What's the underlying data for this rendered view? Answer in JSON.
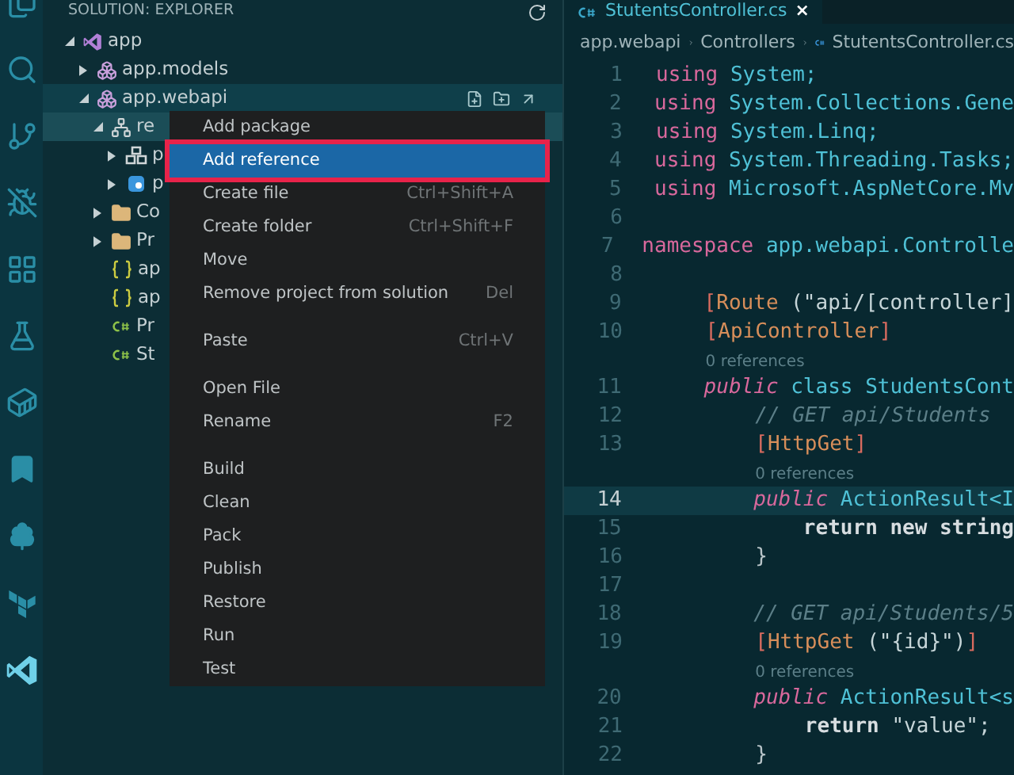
{
  "activity_bar": [
    {
      "kind": "files",
      "selected": false
    },
    {
      "kind": "search",
      "selected": false
    },
    {
      "kind": "source-control",
      "selected": false
    },
    {
      "kind": "debug",
      "selected": false
    },
    {
      "kind": "extensions",
      "selected": false
    },
    {
      "kind": "test",
      "selected": false
    },
    {
      "kind": "docker",
      "selected": false
    },
    {
      "kind": "bookmarks",
      "selected": false
    },
    {
      "kind": "tree",
      "selected": false
    },
    {
      "kind": "terraform",
      "selected": false
    },
    {
      "kind": "solution",
      "selected": true
    }
  ],
  "explorer": {
    "title": "SOLUTION: EXPLORER",
    "tree": [
      {
        "label": "app",
        "kind": "solution",
        "expanded": true,
        "selected": false,
        "hovered": false,
        "children": [
          {
            "label": "app.models",
            "kind": "project",
            "expanded": false,
            "selected": false,
            "hovered": false
          },
          {
            "label": "app.webapi",
            "kind": "project",
            "expanded": true,
            "selected": false,
            "hovered": true,
            "children": [
              {
                "label": "re",
                "kind": "references",
                "expanded": true,
                "selected": true,
                "hovered": false,
                "children": [
                  {
                    "label": "p",
                    "kind": "package",
                    "expanded": false,
                    "selected": false,
                    "hovered": false
                  },
                  {
                    "label": "p",
                    "kind": "nuget",
                    "expanded": false,
                    "selected": false,
                    "hovered": false
                  }
                ]
              },
              {
                "label": "Co",
                "kind": "folder",
                "expanded": false,
                "selected": false,
                "hovered": false
              },
              {
                "label": "Pr",
                "kind": "folder",
                "expanded": false,
                "selected": false,
                "hovered": false
              },
              {
                "label": "ap",
                "kind": "json",
                "selected": false,
                "hovered": false
              },
              {
                "label": "ap",
                "kind": "json",
                "selected": false,
                "hovered": false
              },
              {
                "label": "Pr",
                "kind": "csharp",
                "selected": false,
                "hovered": false
              },
              {
                "label": "St",
                "kind": "csharp",
                "selected": false,
                "hovered": false
              }
            ]
          }
        ]
      }
    ]
  },
  "context_menu": {
    "items": [
      {
        "label": "Add package",
        "selected": false
      },
      {
        "label": "Add reference",
        "selected": true
      },
      {
        "label": "Create file",
        "shortcut": "Ctrl+Shift+A",
        "selected": false
      },
      {
        "label": "Create folder",
        "shortcut": "Ctrl+Shift+F",
        "selected": false
      },
      {
        "label": "Move",
        "selected": false
      },
      {
        "label": "Remove project from solution",
        "shortcut": "Del",
        "selected": false,
        "separator_after": true
      },
      {
        "label": "Paste",
        "shortcut": "Ctrl+V",
        "selected": false,
        "separator_after": true
      },
      {
        "label": "Open File",
        "selected": false
      },
      {
        "label": "Rename",
        "shortcut": "F2",
        "selected": false,
        "separator_after": true
      },
      {
        "label": "Build",
        "selected": false
      },
      {
        "label": "Clean",
        "selected": false
      },
      {
        "label": "Pack",
        "selected": false
      },
      {
        "label": "Publish",
        "selected": false
      },
      {
        "label": "Restore",
        "selected": false
      },
      {
        "label": "Run",
        "selected": false
      },
      {
        "label": "Test",
        "selected": false
      }
    ]
  },
  "editor": {
    "tab": {
      "label": "StutentsController.cs",
      "close": "×"
    },
    "breadcrumb": [
      {
        "label": "app.webapi",
        "kind": "folder"
      },
      {
        "label": "Controllers",
        "kind": "folder"
      },
      {
        "label": "StutentsController.cs",
        "kind": "csharp"
      }
    ],
    "lines": [
      {
        "kind": "code",
        "number": "1",
        "current": false,
        "tokens": [
          {
            "kind": "kw",
            "text": "using"
          },
          {
            "kind": "type",
            "text": " System;"
          }
        ]
      },
      {
        "kind": "code",
        "number": "2",
        "current": false,
        "tokens": [
          {
            "kind": "kw",
            "text": "using"
          },
          {
            "kind": "type",
            "text": " System.Collections.Gene"
          }
        ]
      },
      {
        "kind": "code",
        "number": "3",
        "current": false,
        "tokens": [
          {
            "kind": "kw",
            "text": "using"
          },
          {
            "kind": "type",
            "text": " System.Linq;"
          }
        ]
      },
      {
        "kind": "code",
        "number": "4",
        "current": false,
        "tokens": [
          {
            "kind": "kw",
            "text": "using"
          },
          {
            "kind": "type",
            "text": " System.Threading.Tasks;"
          }
        ]
      },
      {
        "kind": "code",
        "number": "5",
        "current": false,
        "tokens": [
          {
            "kind": "kw",
            "text": "using"
          },
          {
            "kind": "type",
            "text": " Microsoft.AspNetCore.Mv"
          }
        ]
      },
      {
        "kind": "code",
        "number": "6",
        "current": false
      },
      {
        "kind": "code",
        "number": "7",
        "current": false,
        "tokens": [
          {
            "kind": "kw",
            "text": "namespace"
          },
          {
            "kind": "type",
            "text": " app.webapi.Controlle"
          }
        ]
      },
      {
        "kind": "code",
        "number": "8",
        "current": false
      },
      {
        "kind": "code",
        "number": "9",
        "current": false,
        "tokens": [
          {
            "kind": "bracket",
            "text": "    ["
          },
          {
            "kind": "attr",
            "text": "Route"
          },
          {
            "kind": "str",
            "text": " (\"api/[controller]"
          }
        ]
      },
      {
        "kind": "code",
        "number": "10",
        "current": false,
        "tokens": [
          {
            "kind": "bracket",
            "text": "    ["
          },
          {
            "kind": "attr",
            "text": "ApiController"
          },
          {
            "kind": "bracket",
            "text": "]"
          }
        ]
      },
      {
        "kind": "lens",
        "text": "0 references"
      },
      {
        "kind": "code",
        "number": "11",
        "current": false,
        "tokens": [
          {
            "kind": "kwi",
            "text": "    public"
          },
          {
            "kind": "type",
            "text": " class StudentsCont"
          }
        ]
      },
      {
        "kind": "code",
        "number": "12",
        "current": false,
        "tokens": [
          {
            "kind": "comment",
            "text": "        // GET api/Students"
          }
        ]
      },
      {
        "kind": "code",
        "number": "13",
        "current": false,
        "tokens": [
          {
            "kind": "bracket",
            "text": "        ["
          },
          {
            "kind": "attr",
            "text": "HttpGet"
          },
          {
            "kind": "bracket",
            "text": "]"
          }
        ]
      },
      {
        "kind": "lens",
        "text": "0 references"
      },
      {
        "kind": "code",
        "number": "14",
        "current": true,
        "tokens": [
          {
            "kind": "kwi",
            "text": "        public"
          },
          {
            "kind": "type",
            "text": " ActionResult<I"
          }
        ]
      },
      {
        "kind": "code",
        "number": "15",
        "current": false,
        "tokens": [
          {
            "kind": "plainb",
            "text": "            return new string"
          }
        ]
      },
      {
        "kind": "code",
        "number": "16",
        "current": false,
        "tokens": [
          {
            "kind": "punct",
            "text": "        }"
          }
        ]
      },
      {
        "kind": "code",
        "number": "17",
        "current": false
      },
      {
        "kind": "code",
        "number": "18",
        "current": false,
        "tokens": [
          {
            "kind": "comment",
            "text": "        // GET api/Students/5"
          }
        ]
      },
      {
        "kind": "code",
        "number": "19",
        "current": false,
        "tokens": [
          {
            "kind": "bracket",
            "text": "        ["
          },
          {
            "kind": "attr",
            "text": "HttpGet"
          },
          {
            "kind": "str",
            "text": " (\"{id}\")"
          },
          {
            "kind": "bracket",
            "text": "]"
          }
        ]
      },
      {
        "kind": "lens",
        "text": "0 references"
      },
      {
        "kind": "code",
        "number": "20",
        "current": false,
        "tokens": [
          {
            "kind": "kwi",
            "text": "        public"
          },
          {
            "kind": "type",
            "text": " ActionResult<s"
          }
        ]
      },
      {
        "kind": "code",
        "number": "21",
        "current": false,
        "tokens": [
          {
            "kind": "plainb",
            "text": "            return"
          },
          {
            "kind": "str",
            "text": " \"value\";"
          }
        ]
      },
      {
        "kind": "code",
        "number": "22",
        "current": false,
        "tokens": [
          {
            "kind": "punct",
            "text": "        }"
          }
        ]
      }
    ]
  }
}
